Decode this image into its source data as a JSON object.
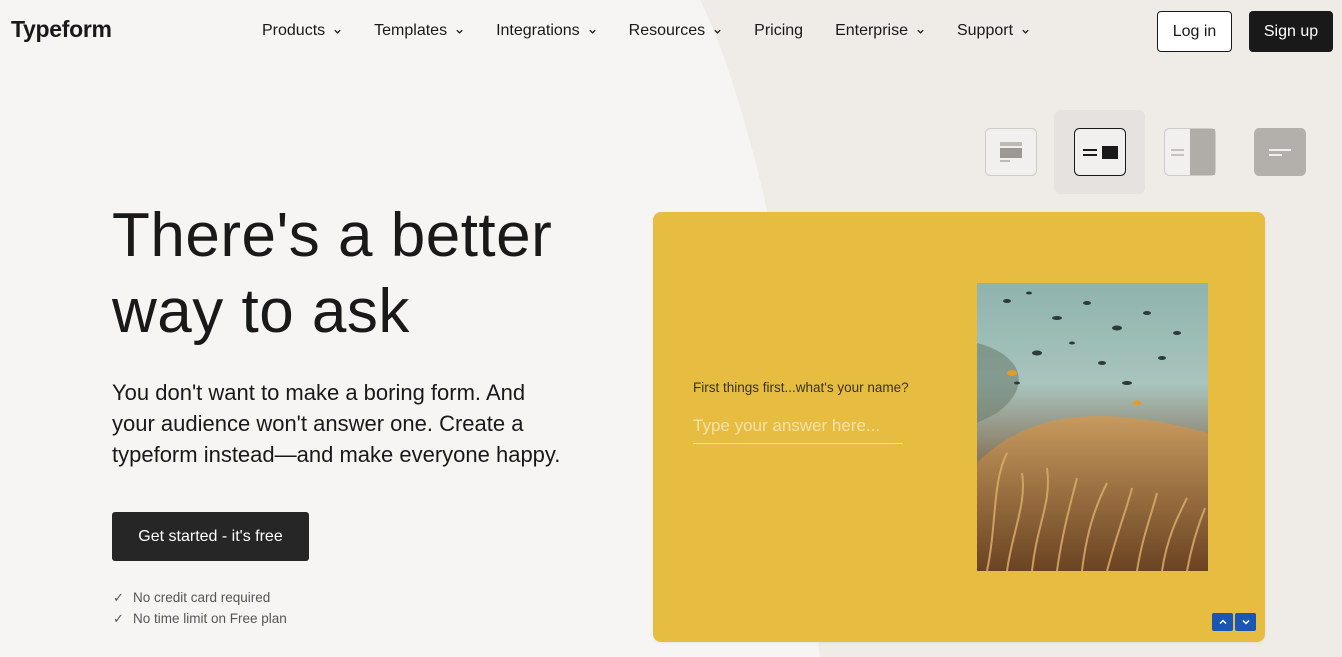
{
  "header": {
    "logo": "Typeform",
    "nav": [
      {
        "label": "Products",
        "has_dropdown": true
      },
      {
        "label": "Templates",
        "has_dropdown": true
      },
      {
        "label": "Integrations",
        "has_dropdown": true
      },
      {
        "label": "Resources",
        "has_dropdown": true
      },
      {
        "label": "Pricing",
        "has_dropdown": false
      },
      {
        "label": "Enterprise",
        "has_dropdown": true
      },
      {
        "label": "Support",
        "has_dropdown": true
      }
    ],
    "login_label": "Log in",
    "signup_label": "Sign up"
  },
  "hero": {
    "title_line1": "There's a better",
    "title_line2": "way to ask",
    "subtitle_line1": "You don't want to make a boring form. And",
    "subtitle_line2": "your audience won't answer one. Create a",
    "subtitle_line3": "typeform instead—and make everyone happy.",
    "cta_label": "Get started - it's free",
    "checks": [
      "No credit card required",
      "No time limit on Free plan"
    ]
  },
  "layout_switcher": {
    "options": [
      "layout-stack-icon",
      "layout-split-icon",
      "layout-side-image-icon",
      "layout-text-only-icon"
    ],
    "selected": 1
  },
  "preview": {
    "question": "First things first...what's your name?",
    "input_placeholder": "Type your answer here...",
    "background_color": "#e7bd41",
    "nav_color": "#1a56b4"
  }
}
